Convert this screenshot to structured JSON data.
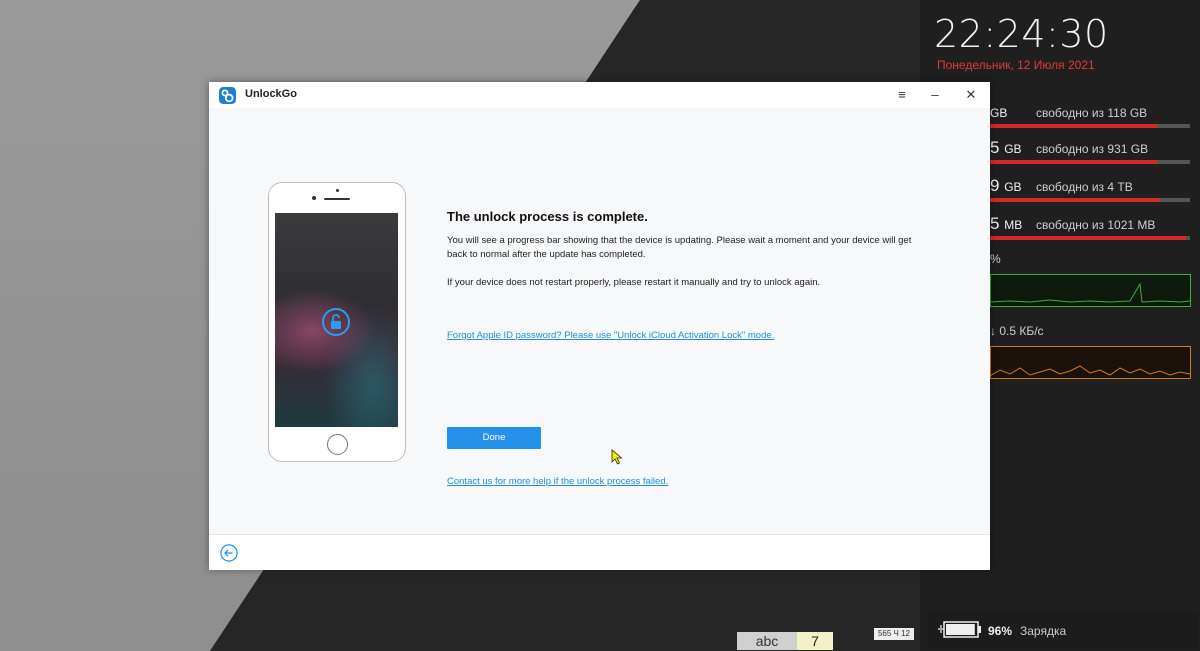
{
  "widget": {
    "clock": "22:24:30",
    "date": "Понедельник, 12 Июля 2021",
    "disks": [
      {
        "num": "",
        "unit": "GB",
        "free": "свободно из 118 GB",
        "used_fraction": 0.84
      },
      {
        "num": "5",
        "unit": "GB",
        "free": "свободно из 931 GB",
        "used_fraction": 0.84
      },
      {
        "num": "9",
        "unit": "GB",
        "free": "свободно из 4 TB",
        "used_fraction": 0.85
      },
      {
        "num": "5",
        "unit": "MB",
        "free": "свободно из 1021 MB",
        "used_fraction": 0.98
      }
    ],
    "cpu_label": "%",
    "net_label": "0.5 КБ/с",
    "battery_pct": "96%",
    "battery_text": "Зарядка",
    "battery_level": 0.96
  },
  "taskbar": {
    "lang": "abc",
    "lang_num": "7",
    "tiny": "565 Ч 12"
  },
  "app": {
    "name": "UnlockGo",
    "menu_icon": "≡",
    "minimize_icon": "–",
    "close_icon": "✕",
    "heading": "The unlock process is complete.",
    "para1": "You will see a progress bar showing that the device is updating. Please wait a moment and your device will get back to normal after the update has completed.",
    "para2": "If your device does not restart properly, please restart it manually and try to unlock again.",
    "link_forgot": "Forgot Apple ID password? Please use \"Unlock iCloud Activation Lock\" mode.",
    "done_label": "Done",
    "link_contact": "Contact us for more help if the unlock process failed.",
    "accent": "#2491ea"
  }
}
